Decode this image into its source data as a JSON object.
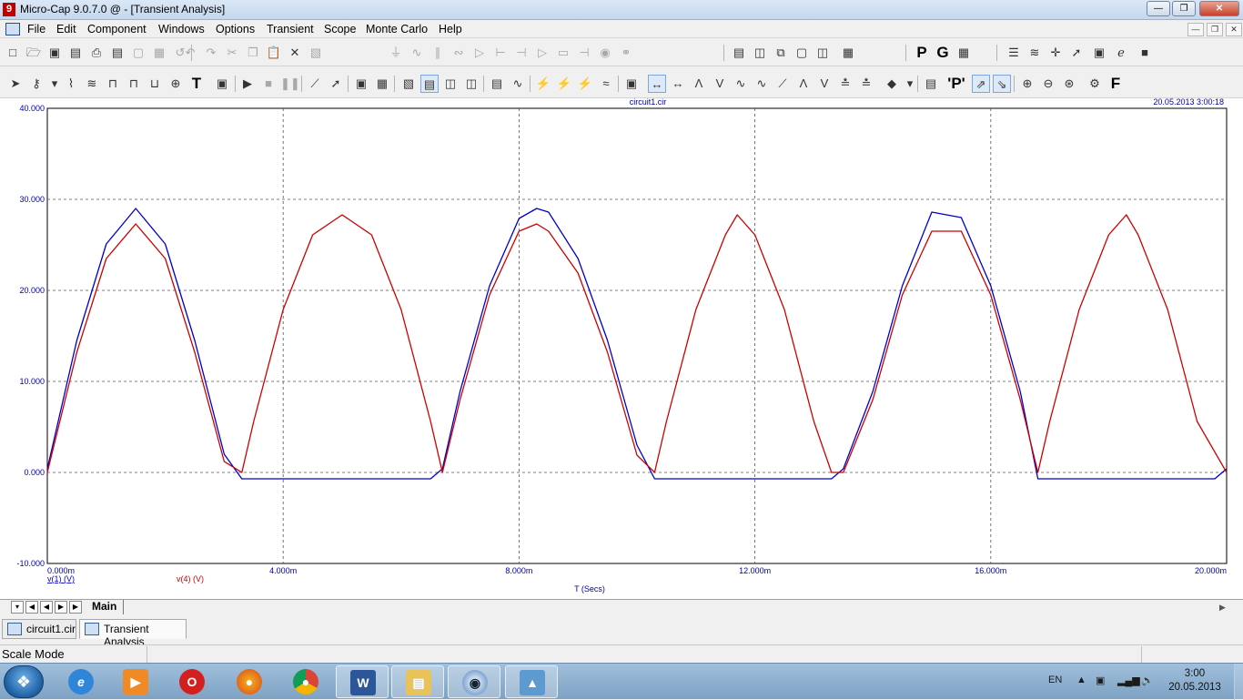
{
  "window": {
    "title": "Micro-Cap 9.0.7.0 @ - [Transient Analysis]",
    "app_icon_glyph": "9",
    "controls": [
      "minimize",
      "restore",
      "close"
    ]
  },
  "menu": {
    "items": [
      "File",
      "Edit",
      "Component",
      "Windows",
      "Options",
      "Transient",
      "Scope",
      "Monte Carlo",
      "Help"
    ]
  },
  "toolbar_labels": {
    "p_button": "P",
    "g_button": "G",
    "t_button": "T",
    "quote_p_button": "'P'",
    "f_button": "F"
  },
  "plot": {
    "file_label": "circuit1.cir",
    "timestamp": "20.05.2013 3:00:18",
    "xlabel": "T (Secs)"
  },
  "chart_data": {
    "type": "line",
    "xlim": [
      0,
      20
    ],
    "ylim": [
      -10,
      40
    ],
    "x_unit_note": "milliseconds",
    "grid": true,
    "x_ticks": [
      "0.000m",
      "4.000m",
      "8.000m",
      "12.000m",
      "16.000m",
      "20.000m"
    ],
    "y_ticks": [
      "-10.000",
      "0.000",
      "10.000",
      "20.000",
      "30.000",
      "40.000"
    ],
    "series": [
      {
        "name": "v(1) (V)",
        "color": "#0000cc",
        "x": [
          0,
          0.5,
          1.0,
          1.5,
          2.0,
          2.5,
          3.0,
          3.3,
          3.5,
          5.0,
          6.5,
          6.7,
          7.0,
          7.5,
          8.0,
          8.3,
          8.5,
          9.0,
          9.5,
          10.0,
          10.3,
          11.7,
          13.3,
          13.5,
          14.0,
          14.5,
          15.0,
          15.5,
          16.0,
          16.5,
          16.8,
          18.3,
          19.8,
          20.0
        ],
        "y": [
          0.4,
          14.5,
          25.1,
          29.0,
          25.1,
          14.5,
          2.0,
          -0.7,
          -0.7,
          -0.7,
          -0.7,
          0.4,
          8.9,
          20.5,
          27.9,
          29.0,
          28.6,
          23.5,
          14.5,
          3.0,
          -0.7,
          -0.7,
          -0.7,
          0.4,
          8.9,
          20.5,
          28.6,
          28.0,
          20.5,
          8.9,
          -0.7,
          -0.7,
          -0.7,
          0.4
        ]
      },
      {
        "name": "v(4) (V)",
        "color": "#cc0000",
        "x": [
          0,
          0.5,
          1.0,
          1.5,
          2.0,
          2.5,
          3.0,
          3.3,
          3.5,
          4.0,
          4.5,
          5.0,
          5.5,
          6.0,
          6.5,
          6.7,
          7.0,
          7.5,
          8.0,
          8.3,
          8.5,
          9.0,
          9.5,
          10.0,
          10.3,
          10.5,
          11.0,
          11.5,
          11.7,
          12.0,
          12.5,
          13.0,
          13.3,
          13.5,
          14.0,
          14.5,
          15.0,
          15.5,
          16.0,
          16.5,
          16.8,
          17.0,
          17.5,
          18.0,
          18.3,
          18.5,
          19.0,
          19.5,
          20.0
        ],
        "y": [
          0.0,
          13.2,
          23.5,
          27.3,
          23.5,
          13.2,
          1.2,
          0.0,
          5.6,
          17.9,
          26.1,
          28.3,
          26.1,
          17.9,
          5.6,
          0.0,
          8.0,
          19.5,
          26.5,
          27.3,
          26.5,
          21.9,
          13.2,
          1.9,
          0.0,
          5.6,
          17.9,
          26.1,
          28.3,
          26.1,
          17.9,
          5.6,
          0.0,
          0.0,
          8.0,
          19.5,
          26.5,
          26.5,
          19.5,
          8.0,
          0.0,
          5.6,
          17.9,
          26.1,
          28.3,
          26.1,
          17.9,
          5.6,
          0.0
        ]
      }
    ]
  },
  "sheet_tabs": {
    "active": "Main"
  },
  "document_tabs": [
    "circuit1.cir",
    "Transient Analysis"
  ],
  "status": {
    "mode": "Scale Mode"
  },
  "taskbar": {
    "apps": [
      "internet-explorer",
      "media-player",
      "opera",
      "firefox",
      "chrome",
      "word",
      "explorer",
      "micro-cap",
      "image-viewer"
    ],
    "language": "EN",
    "clock_time": "3:00",
    "clock_date": "20.05.2013"
  }
}
